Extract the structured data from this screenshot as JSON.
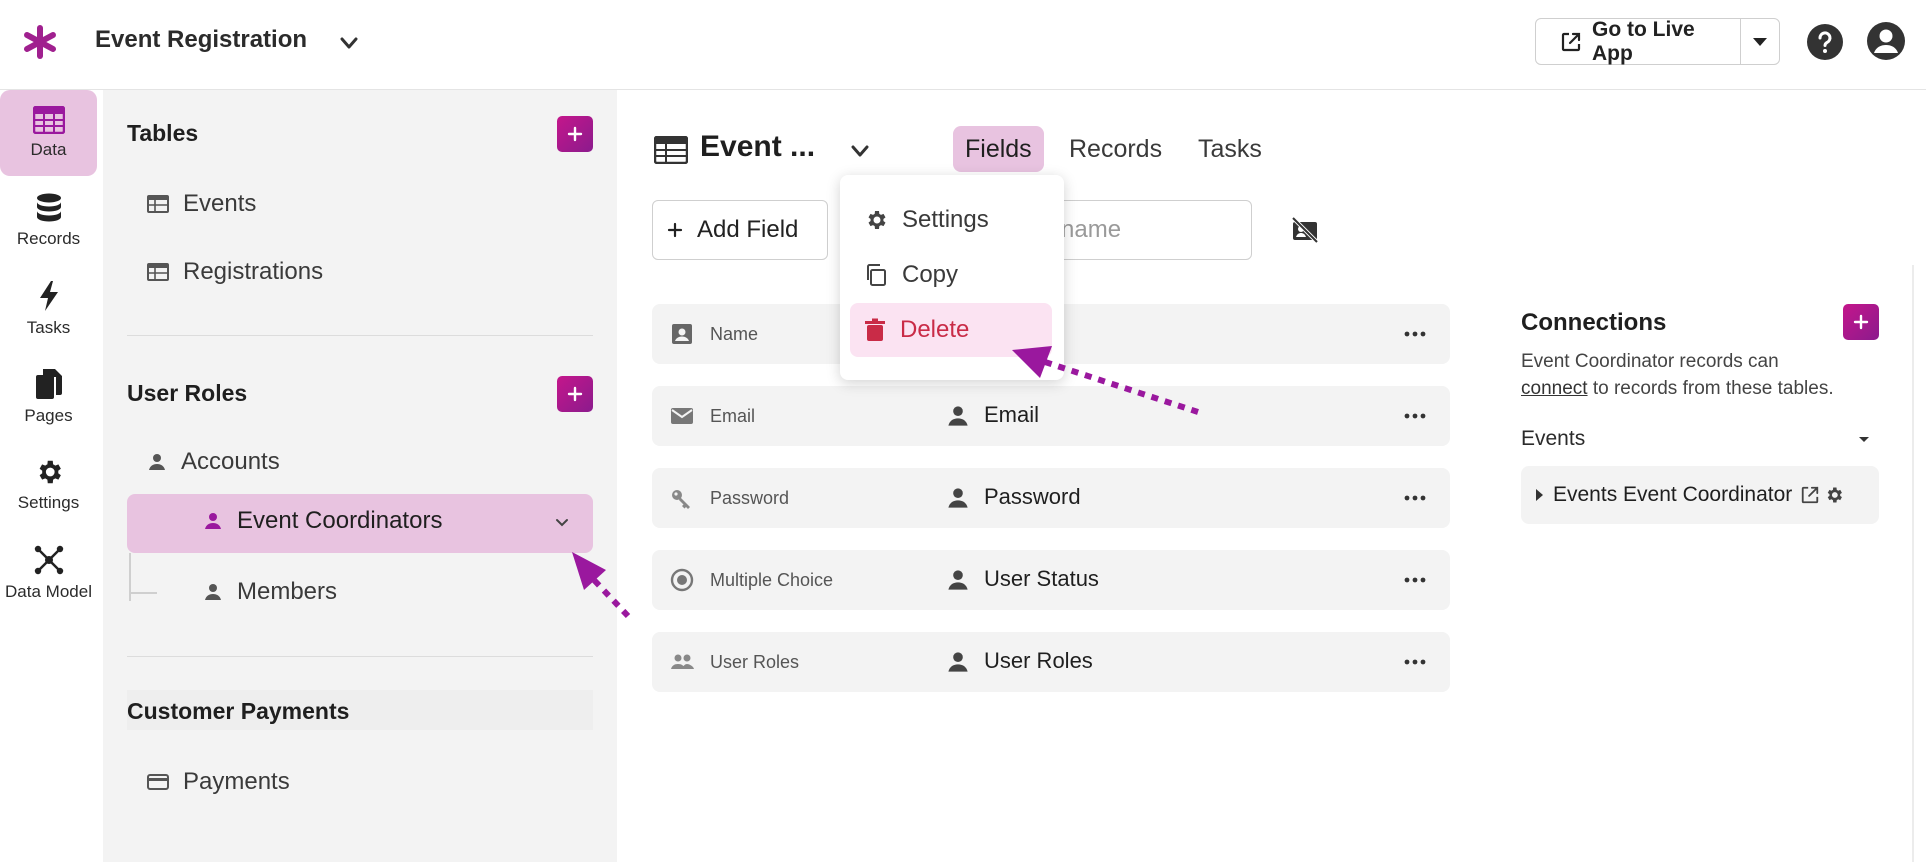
{
  "app": {
    "title": "Event Registration",
    "brand_color": "#a0208f",
    "live_button_label": "Go to Live App"
  },
  "rail": {
    "items": [
      {
        "label": "Data",
        "icon": "table-icon",
        "active": true
      },
      {
        "label": "Records",
        "icon": "database-icon",
        "active": false
      },
      {
        "label": "Tasks",
        "icon": "bolt-icon",
        "active": false
      },
      {
        "label": "Pages",
        "icon": "pages-icon",
        "active": false
      },
      {
        "label": "Settings",
        "icon": "gear-icon",
        "active": false
      },
      {
        "label": "Data Model",
        "icon": "data-model-icon",
        "active": false
      }
    ]
  },
  "sidebar": {
    "tables_title": "Tables",
    "tables": [
      {
        "label": "Events",
        "icon": "table-icon"
      },
      {
        "label": "Registrations",
        "icon": "table-icon"
      }
    ],
    "user_roles_title": "User Roles",
    "user_roles": [
      {
        "label": "Accounts",
        "icon": "person-icon"
      },
      {
        "label": "Event Coordinators",
        "icon": "person-icon",
        "active": true
      },
      {
        "label": "Members",
        "icon": "person-icon"
      }
    ],
    "customer_payments_title": "Customer Payments",
    "customer_payments": [
      {
        "label": "Payments",
        "icon": "card-icon"
      }
    ]
  },
  "main": {
    "title": "Event ...",
    "tabs": [
      {
        "label": "Fields",
        "active": true
      },
      {
        "label": "Records",
        "active": false
      },
      {
        "label": "Tasks",
        "active": false
      }
    ],
    "add_field_label": "Add Field",
    "search_placeholder": "name",
    "fields": [
      {
        "type": "Name",
        "type_icon": "name-card-icon",
        "name": ""
      },
      {
        "type": "Email",
        "type_icon": "envelope-icon",
        "name": "Email"
      },
      {
        "type": "Password",
        "type_icon": "key-icon",
        "name": "Password"
      },
      {
        "type": "Multiple Choice",
        "type_icon": "radio-icon",
        "name": "User Status"
      },
      {
        "type": "User Roles",
        "type_icon": "people-icon",
        "name": "User Roles"
      }
    ]
  },
  "menu": {
    "items": [
      {
        "label": "Settings",
        "icon": "gear-icon"
      },
      {
        "label": "Copy",
        "icon": "copy-icon"
      },
      {
        "label": "Delete",
        "icon": "trash-icon",
        "danger": true
      }
    ]
  },
  "connections": {
    "title": "Connections",
    "desc_prefix": "Event Coordinator records can",
    "desc_link": "connect",
    "desc_suffix": "to records from these tables.",
    "group_label": "Events",
    "card_label": "Events Event Coordinator"
  },
  "colors": {
    "accent": "#a0208f",
    "active_bg": "#e8c3e0",
    "danger": "#c92b47",
    "annotation_arrow": "#9a189e"
  }
}
